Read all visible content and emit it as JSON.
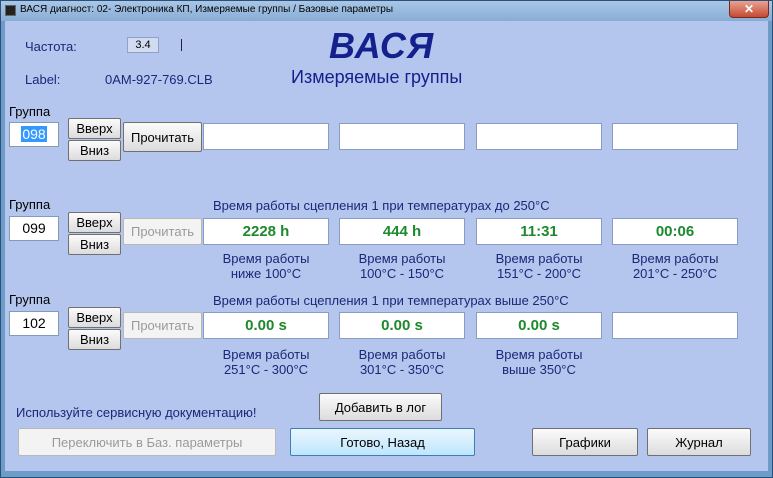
{
  "window": {
    "title": "ВАСЯ диагност: 02- Электроника КП,  Измеряемые группы / Базовые параметры",
    "close_glyph": "✕"
  },
  "header": {
    "freq_label": "Частота:",
    "freq_value": "3.4",
    "label_label": "Label:",
    "label_value": "0AM-927-769.CLB",
    "app_title": "ВАСЯ",
    "subtitle": "Измеряемые группы"
  },
  "groups": [
    {
      "label": "Группа",
      "number": "098",
      "up": "Вверх",
      "down": "Вниз",
      "read": "Прочитать",
      "read_enabled": true,
      "title": "",
      "values": [
        "",
        "",
        "",
        ""
      ],
      "captions": [
        "",
        "",
        "",
        ""
      ]
    },
    {
      "label": "Группа",
      "number": "099",
      "up": "Вверх",
      "down": "Вниз",
      "read": "Прочитать",
      "read_enabled": false,
      "title": "Время работы сцепления 1 при температурах до 250°C",
      "values": [
        "2228 h",
        "444 h",
        "11:31",
        "00:06"
      ],
      "captions": [
        "Время работы\nниже 100°C",
        "Время работы\n100°C - 150°C",
        "Время работы\n151°C - 200°C",
        "Время работы\n201°C - 250°C"
      ]
    },
    {
      "label": "Группа",
      "number": "102",
      "up": "Вверх",
      "down": "Вниз",
      "read": "Прочитать",
      "read_enabled": false,
      "title": "Время работы сцепления 1 при температурах выше 250°C",
      "values": [
        "0.00 s",
        "0.00 s",
        "0.00 s",
        ""
      ],
      "captions": [
        "Время работы\n251°C - 300°C",
        "Время работы\n301°C - 350°C",
        "Время работы\nвыше 350°C",
        ""
      ]
    }
  ],
  "footer": {
    "hint": "Используйте сервисную документацию!",
    "add_log": "Добавить в лог",
    "switch_basic": "Переключить в Баз. параметры",
    "done_back": "Готово, Назад",
    "graphs": "Графики",
    "journal": "Журнал"
  },
  "colors": {
    "value_green": "#1c8a2c",
    "title_navy": "#14208c",
    "background": "#b4c6ee"
  }
}
